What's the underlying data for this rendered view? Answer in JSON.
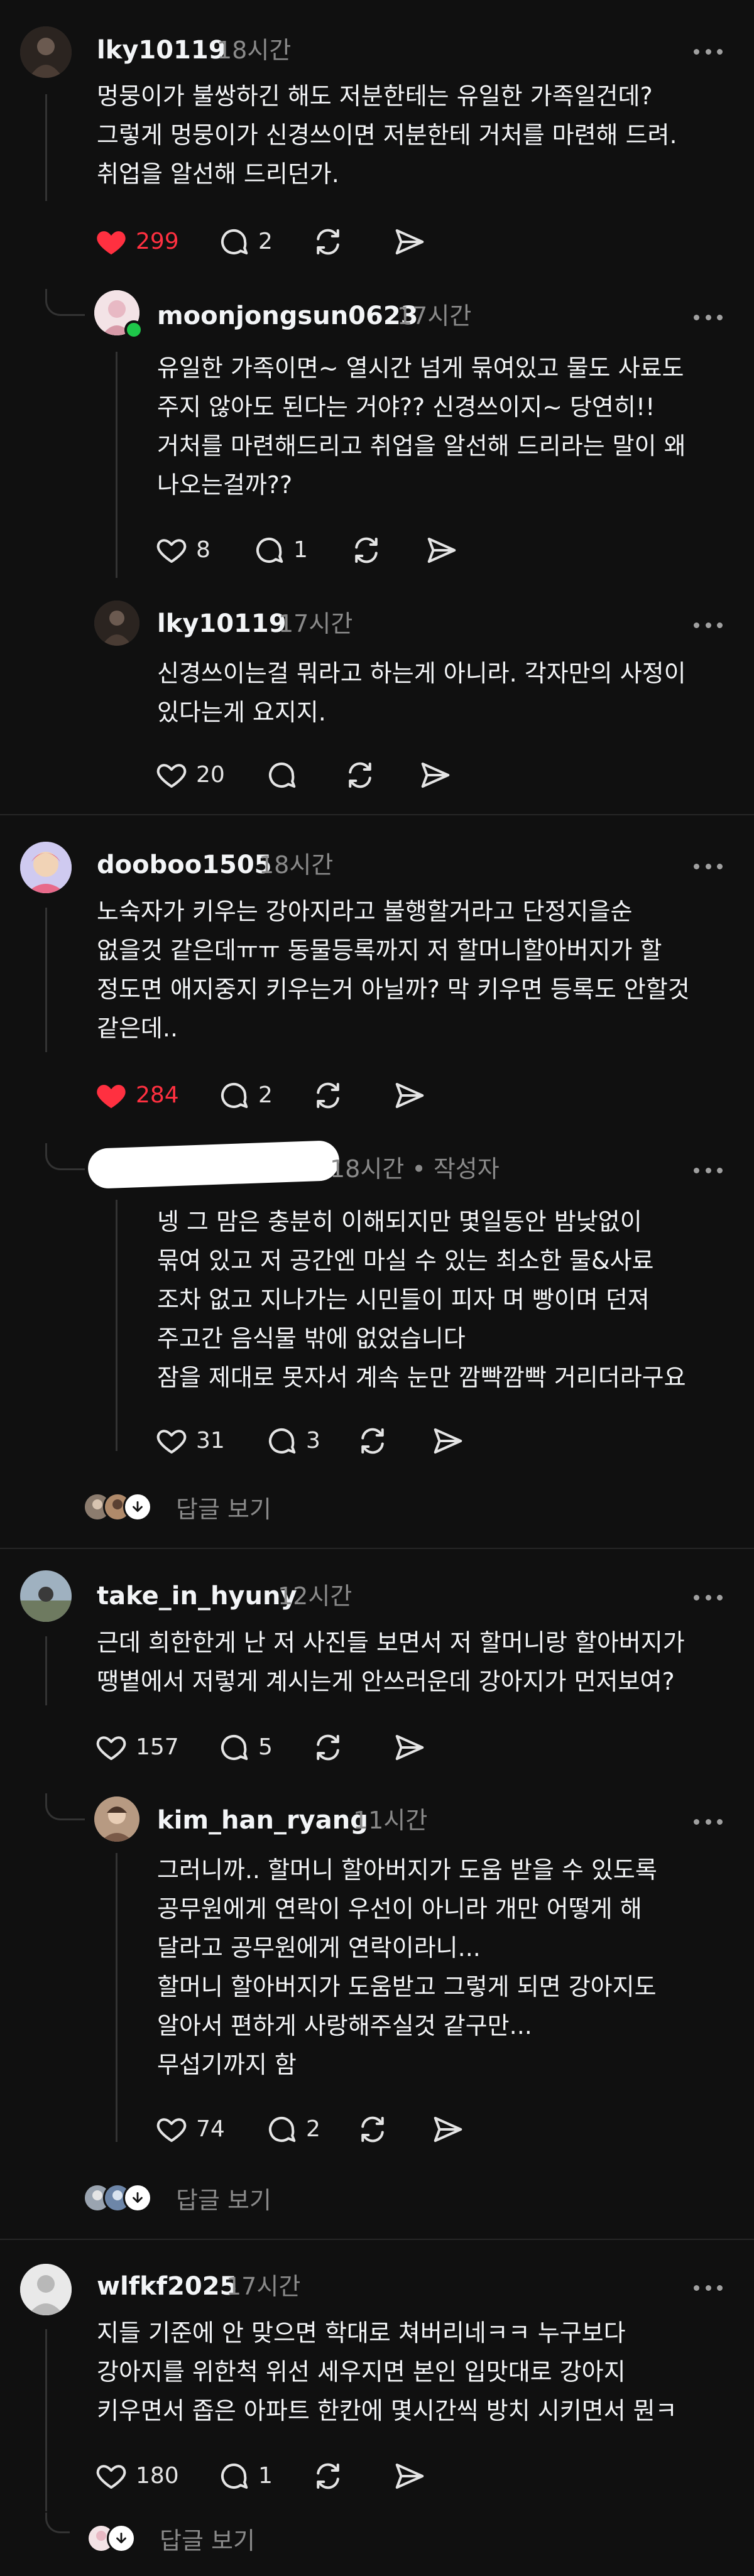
{
  "comments": [
    {
      "username": "lky10119",
      "time": "18시간",
      "text": "멍뭉이가 불쌍하긴 해도 저분한테는 유일한 가족일건데?\n그렇게 멍뭉이가 신경쓰이면 저분한테 거처를 마련해 드려.\n취업을 알선해 드리던가.",
      "likes": "299",
      "replies": "2",
      "liked": true
    },
    {
      "username": "moonjongsun0623",
      "time": "17시간",
      "text": "유일한 가족이면~ 열시간 넘게 묶여있고 물도 사료도\n주지 않아도 된다는 거야?? 신경쓰이지~ 당연히!!\n거처를 마련해드리고  취업을 알선해 드리라는 말이 왜\n나오는걸까??",
      "likes": "8",
      "replies": "1"
    },
    {
      "username": "lky10119",
      "time": "17시간",
      "text": "신경쓰이는걸 뭐라고 하는게 아니라. 각자만의 사정이\n있다는게 요지지.",
      "likes": "20",
      "replies": ""
    },
    {
      "username": "dooboo1505",
      "time": "18시간",
      "text": "노숙자가 키우는 강아지라고 불행할거라고 단정지을순\n없을것 같은데ㅠㅠ 동물등록까지 저 할머니할아버지가 할\n정도면 애지중지 키우는거 아닐까? 막 키우면 등록도 안할것\n같은데..",
      "likes": "284",
      "replies": "2",
      "liked": true
    },
    {
      "username": "",
      "time": "18시간 • 작성자",
      "text": "넹 그 맘은 충분히 이해되지만  몇일동안 밤낮없이\n묶여 있고  저 공간엔 마실 수  있는 최소한  물&사료\n조차 없고  지나가는 시민들이  피자 며  빵이며  던져\n주고간 음식물 밖에 없었습니다\n잠을 제대로 못자서  계속 눈만 깜빡깜빡 거리더라구요",
      "likes": "31",
      "replies": "3"
    },
    {
      "username": "take_in_hyuny",
      "time": "12시간",
      "text": "근데 희한한게 난 저 사진들 보면서 저 할머니랑 할아버지가\n땡볕에서 저렇게 계시는게 안쓰러운데 강아지가 먼저보여?",
      "likes": "157",
      "replies": "5"
    },
    {
      "username": "kim_han_ryang",
      "time": "11시간",
      "text": "그러니까.. 할머니 할아버지가 도움 받을 수 있도록\n공무원에게 연락이 우선이 아니라 개만 어떻게 해\n달라고 공무원에게 연락이라니...\n할머니 할아버지가 도움받고 그렇게 되면 강아지도\n알아서 편하게 사랑해주실것 같구만...\n무섭기까지 함",
      "likes": "74",
      "replies": "2"
    },
    {
      "username": "wlfkf2025",
      "time": "17시간",
      "text": "지들 기준에 안 맞으면 학대로 쳐버리네ㅋㅋ 누구보다\n강아지를 위한척 위선 세우지면 본인 입맛대로 강아지\n키우면서 좁은 아파트 한칸에 몇시간씩 방치 시키면서 뭔ㅋ",
      "likes": "180",
      "replies": "1"
    }
  ],
  "view_replies_label": "답글 보기",
  "colors": {
    "background": "#101010",
    "like": "#ff3040",
    "muted": "#8a8a8a",
    "separator": "#262626"
  }
}
